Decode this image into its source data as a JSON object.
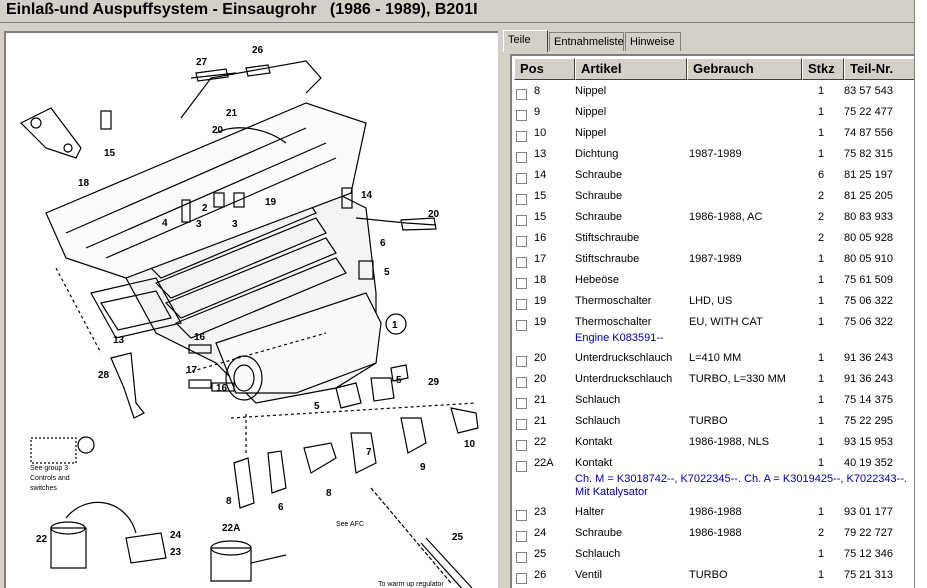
{
  "window": {
    "title": "Einlaß-und Auspuffsystem - Einsaugrohr   (1986 - 1989), B201I"
  },
  "tabs": [
    {
      "label": "Teile"
    },
    {
      "label": "Entnahmeliste"
    },
    {
      "label": "Hinweise"
    }
  ],
  "table": {
    "headers": {
      "pos": "Pos",
      "artikel": "Artikel",
      "gebrauch": "Gebrauch",
      "stkz": "Stkz",
      "teilnr": "Teil-Nr."
    },
    "rows": [
      {
        "pos": "8",
        "artikel": "Nippel",
        "gebrauch": "",
        "stkz": "1",
        "teilnr": "83 57 543"
      },
      {
        "pos": "9",
        "artikel": "Nippel",
        "gebrauch": "",
        "stkz": "1",
        "teilnr": "75 22 477"
      },
      {
        "pos": "10",
        "artikel": "Nippel",
        "gebrauch": "",
        "stkz": "1",
        "teilnr": "74 87 556"
      },
      {
        "pos": "13",
        "artikel": "Dichtung",
        "gebrauch": "1987-1989",
        "stkz": "1",
        "teilnr": "75 82 315"
      },
      {
        "pos": "14",
        "artikel": "Schraube",
        "gebrauch": "",
        "stkz": "6",
        "teilnr": "81 25 197"
      },
      {
        "pos": "15",
        "artikel": "Schraube",
        "gebrauch": "",
        "stkz": "2",
        "teilnr": "81 25 205"
      },
      {
        "pos": "15",
        "artikel": "Schraube",
        "gebrauch": "1986-1988, AC",
        "stkz": "2",
        "teilnr": "80 83 933"
      },
      {
        "pos": "16",
        "artikel": "Stiftschraube",
        "gebrauch": "",
        "stkz": "2",
        "teilnr": "80 05 928"
      },
      {
        "pos": "17",
        "artikel": "Stiftschraube",
        "gebrauch": "1987-1989",
        "stkz": "1",
        "teilnr": "80 05 910"
      },
      {
        "pos": "18",
        "artikel": "Hebeöse",
        "gebrauch": "",
        "stkz": "1",
        "teilnr": "75 61 509"
      },
      {
        "pos": "19",
        "artikel": "Thermoschalter",
        "gebrauch": "LHD, US",
        "stkz": "1",
        "teilnr": "75 06 322"
      },
      {
        "pos": "19",
        "artikel": "Thermoschalter",
        "gebrauch": "EU, WITH CAT",
        "stkz": "1",
        "teilnr": "75 06 322",
        "note": "Engine K083591--"
      },
      {
        "pos": "20",
        "artikel": "Unterdruckschlauch",
        "gebrauch": "L=410 MM",
        "stkz": "1",
        "teilnr": "91 36 243"
      },
      {
        "pos": "20",
        "artikel": "Unterdruckschlauch",
        "gebrauch": "TURBO, L=330 MM",
        "stkz": "1",
        "teilnr": "91 36 243"
      },
      {
        "pos": "21",
        "artikel": "Schlauch",
        "gebrauch": "",
        "stkz": "1",
        "teilnr": "75 14 375"
      },
      {
        "pos": "21",
        "artikel": "Schlauch",
        "gebrauch": "TURBO",
        "stkz": "1",
        "teilnr": "75 22 295"
      },
      {
        "pos": "22",
        "artikel": "Kontakt",
        "gebrauch": "1986-1988, NLS",
        "stkz": "1",
        "teilnr": "93 15 953"
      },
      {
        "pos": "22A",
        "artikel": "Kontakt",
        "gebrauch": "",
        "stkz": "1",
        "teilnr": "40 19 352",
        "note": "Ch. M = K3018742--, K7022345--. Ch. A = K3019425--, K7022343--.",
        "note2": "Mit Katalysator"
      },
      {
        "pos": "23",
        "artikel": "Halter",
        "gebrauch": "1986-1988",
        "stkz": "1",
        "teilnr": "93 01 177"
      },
      {
        "pos": "24",
        "artikel": "Schraube",
        "gebrauch": "1986-1988",
        "stkz": "2",
        "teilnr": "79 22 727"
      },
      {
        "pos": "25",
        "artikel": "Schlauch",
        "gebrauch": "",
        "stkz": "1",
        "teilnr": "75 12 346"
      },
      {
        "pos": "26",
        "artikel": "Ventil",
        "gebrauch": "TURBO",
        "stkz": "1",
        "teilnr": "75 21 313"
      }
    ]
  },
  "diagram": {
    "labels": [
      "27",
      "26",
      "21",
      "20",
      "15",
      "18",
      "2",
      "19",
      "14",
      "4",
      "3",
      "3",
      "20",
      "6",
      "5",
      "1",
      "13",
      "16",
      "28",
      "17",
      "16",
      "5",
      "29",
      "5",
      "10",
      "7",
      "9",
      "8",
      "6",
      "8",
      "22",
      "24",
      "23",
      "22A",
      "25"
    ],
    "notes": [
      "See group 3",
      "Controls and",
      "switches",
      "See AFC",
      "To warm up regulator"
    ]
  }
}
